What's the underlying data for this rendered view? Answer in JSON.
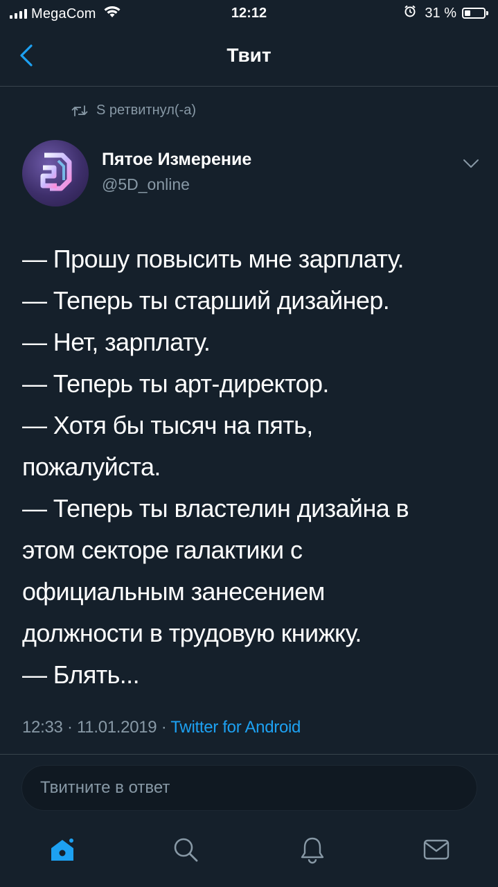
{
  "status_bar": {
    "carrier": "MegaCom",
    "time": "12:12",
    "battery_percent": "31 %",
    "battery_level": 0.31
  },
  "nav": {
    "title": "Твит",
    "back_icon": "chevron-left-icon"
  },
  "tweet": {
    "retweeted_by": "S ретвитнул(-а)",
    "author": {
      "name": "Пятое Измерение",
      "handle": "@5D_online"
    },
    "lines": [
      "— Прошу повысить мне зарплату.",
      "— Теперь ты старший дизайнер.",
      "— Нет, зарплату.",
      "— Теперь ты арт-директор.",
      "— Хотя бы тысяч на пять,",
      "пожалуйста.",
      "— Теперь ты властелин дизайна в",
      "этом секторе галактики с",
      "официальным занесением",
      "должности в трудовую книжку.",
      "— Блять..."
    ],
    "meta": {
      "time": "12:33",
      "date": "11.01.2019",
      "separator": "·",
      "source": "Twitter for Android"
    }
  },
  "reply": {
    "placeholder": "Твитните в ответ"
  },
  "tab_bar": {
    "items": [
      {
        "icon": "home-icon",
        "active": true
      },
      {
        "icon": "search-icon",
        "active": false
      },
      {
        "icon": "bell-icon",
        "active": false
      },
      {
        "icon": "mail-icon",
        "active": false
      }
    ]
  },
  "colors": {
    "background": "#15202b",
    "accent": "#1da1f2",
    "secondary_text": "#8899a6",
    "divider": "#38444d"
  }
}
